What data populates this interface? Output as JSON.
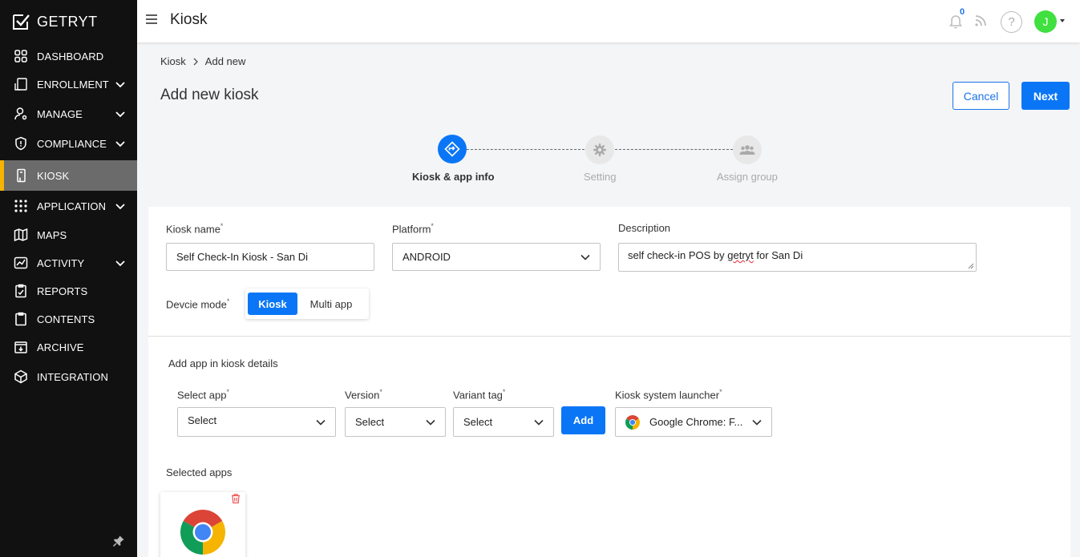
{
  "brand": {
    "name": "GETRYT"
  },
  "sidebar": {
    "items": [
      {
        "label": "DASHBOARD",
        "icon": "dashboard-grid-icon",
        "expandable": false
      },
      {
        "label": "ENROLLMENT",
        "icon": "tablet-icon",
        "expandable": true
      },
      {
        "label": "MANAGE",
        "icon": "user-gear-icon",
        "expandable": true
      },
      {
        "label": "COMPLIANCE",
        "icon": "shield-icon",
        "expandable": true
      },
      {
        "label": "KIOSK",
        "icon": "kiosk-icon",
        "expandable": false,
        "active": true
      },
      {
        "label": "APPLICATION",
        "icon": "apps-grid-icon",
        "expandable": true
      },
      {
        "label": "MAPS",
        "icon": "map-icon",
        "expandable": false
      },
      {
        "label": "ACTIVITY",
        "icon": "activity-chart-icon",
        "expandable": true
      },
      {
        "label": "REPORTS",
        "icon": "report-icon",
        "expandable": false
      },
      {
        "label": "CONTENTS",
        "icon": "clipboard-icon",
        "expandable": false
      },
      {
        "label": "ARCHIVE",
        "icon": "archive-icon",
        "expandable": false
      },
      {
        "label": "INTEGRATION",
        "icon": "cube-icon",
        "expandable": false
      }
    ]
  },
  "header": {
    "title": "Kiosk",
    "notification_count": "0",
    "help_label": "?",
    "avatar_initial": "J"
  },
  "breadcrumb": {
    "root": "Kiosk",
    "current": "Add new"
  },
  "page": {
    "title": "Add new kiosk",
    "cancel_label": "Cancel",
    "next_label": "Next"
  },
  "stepper": {
    "steps": [
      {
        "label": "Kiosk & app info",
        "state": "active"
      },
      {
        "label": "Setting",
        "state": "inactive"
      },
      {
        "label": "Assign group",
        "state": "inactive"
      }
    ]
  },
  "form": {
    "kiosk_name": {
      "label": "Kiosk name",
      "required_mark": "*",
      "value": "Self Check-In Kiosk - San Di"
    },
    "platform": {
      "label": "Platform",
      "required_mark": "*",
      "value": "ANDROID"
    },
    "description": {
      "label": "Description",
      "value_prefix": "self check-in POS by ",
      "value_misspelled": "getryt",
      "value_suffix": " for San Di"
    },
    "device_mode": {
      "label": "Devcie mode",
      "required_mark": "*",
      "options": [
        "Kiosk",
        "Multi app"
      ],
      "selected": "Kiosk"
    }
  },
  "apps_section": {
    "title": "Add app in kiosk details",
    "select_app": {
      "label": "Select app",
      "required_mark": "*",
      "value": "Select"
    },
    "version": {
      "label": "Version",
      "required_mark": "*",
      "value": "Select"
    },
    "variant_tag": {
      "label": "Variant tag",
      "required_mark": "*",
      "value": "Select"
    },
    "add_label": "Add",
    "launcher": {
      "label": "Kiosk system launcher",
      "required_mark": "*",
      "value": "Google Chrome: F..."
    },
    "selected_title": "Selected apps"
  },
  "colors": {
    "primary": "#0a76f6",
    "sidebar_bg": "#111111",
    "active_accent": "#f4b400",
    "avatar": "#3fe03f"
  }
}
